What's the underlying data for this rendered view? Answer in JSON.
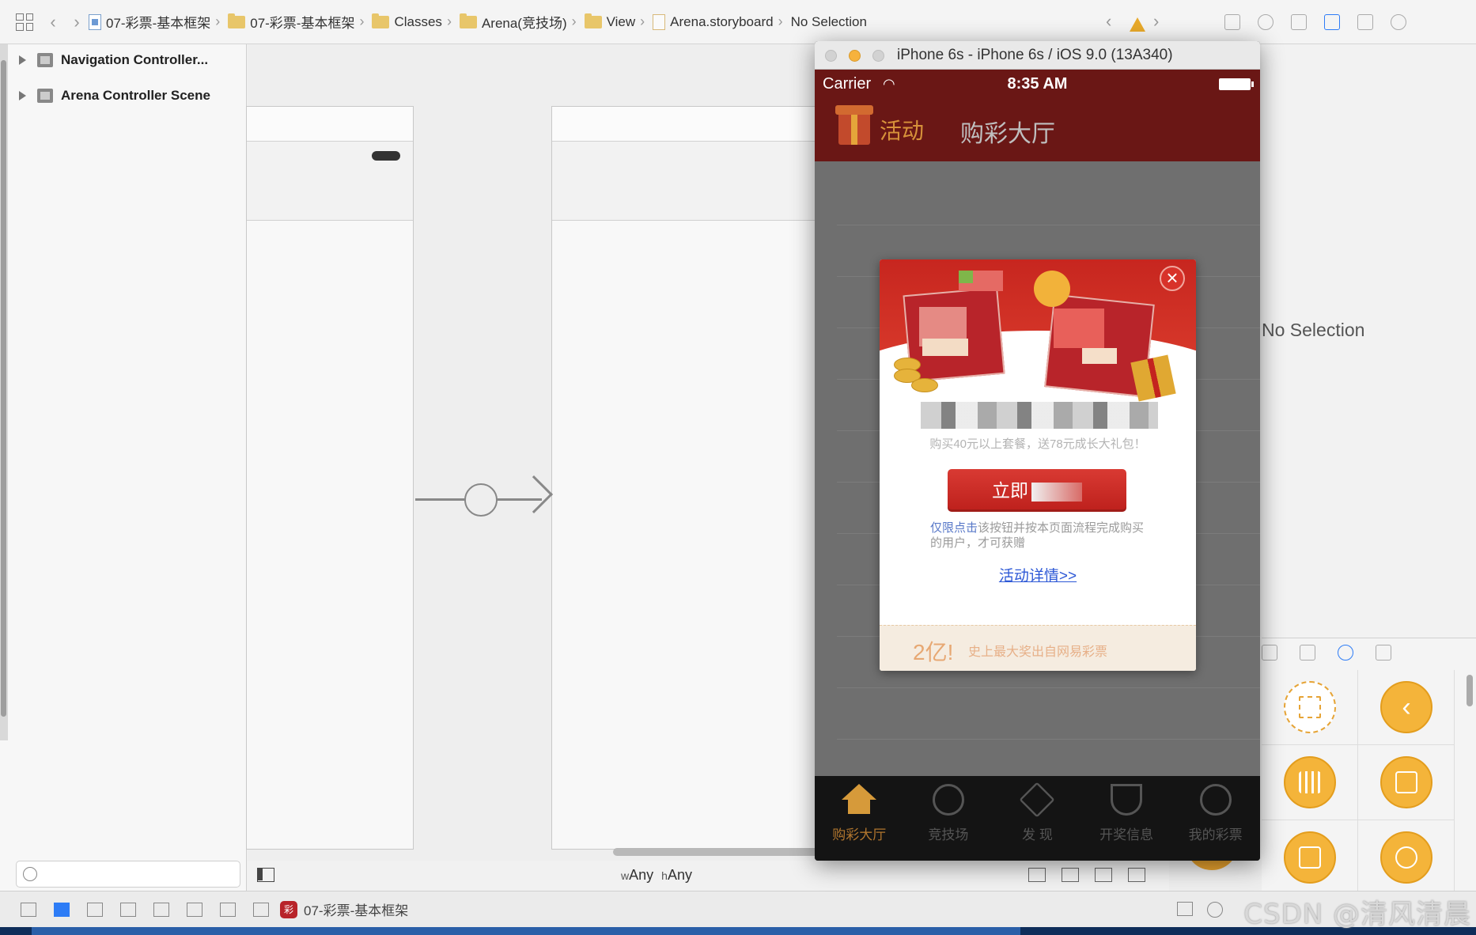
{
  "breadcrumbs": [
    "07-彩票-基本框架",
    "07-彩票-基本框架",
    "Classes",
    "Arena(竞技场)",
    "View",
    "Arena.storyboard",
    "No Selection"
  ],
  "navigator": {
    "items": [
      "Navigation Controller...",
      "Arena Controller Scene"
    ]
  },
  "canvas": {
    "size_class_w": "w",
    "size_class_w_value": "Any",
    "size_class_h": "h",
    "size_class_h_value": "Any"
  },
  "inspector": {
    "no_selection": "No Selection"
  },
  "debug": {
    "scheme_name": "07-彩票-基本框架"
  },
  "simulator": {
    "window_title": "iPhone 6s - iPhone 6s / iOS 9.0 (13A340)",
    "status": {
      "carrier": "Carrier",
      "time": "8:35 AM"
    },
    "navbar": {
      "left_label": "活动",
      "title": "购彩大厅"
    },
    "popup": {
      "close_glyph": "×",
      "subtitle": "购买40元以上套餐，送78元成长大礼包！",
      "button_prefix": "立即",
      "note_highlight": "仅限点击",
      "note_rest": "该按钮并按本页面流程完成购买的用户，才可获赠",
      "details_link": "活动详情>>",
      "footer_big": "2亿!",
      "footer_text": "史上最大奖出自网易彩票"
    },
    "tabs": [
      {
        "label": "购彩大厅",
        "icon": "home-icon"
      },
      {
        "label": "竞技场",
        "icon": "soccer-ball-icon"
      },
      {
        "label": "发 现",
        "icon": "diamond-icon"
      },
      {
        "label": "开奖信息",
        "icon": "trophy-icon"
      },
      {
        "label": "我的彩票",
        "icon": "person-icon"
      }
    ]
  },
  "watermark": "CSDN @清风清晨",
  "colors": {
    "navbar": "#6a1715",
    "accent_gold": "#d7923a",
    "popup_red": "#c7261f",
    "link_blue": "#2d58d6"
  }
}
